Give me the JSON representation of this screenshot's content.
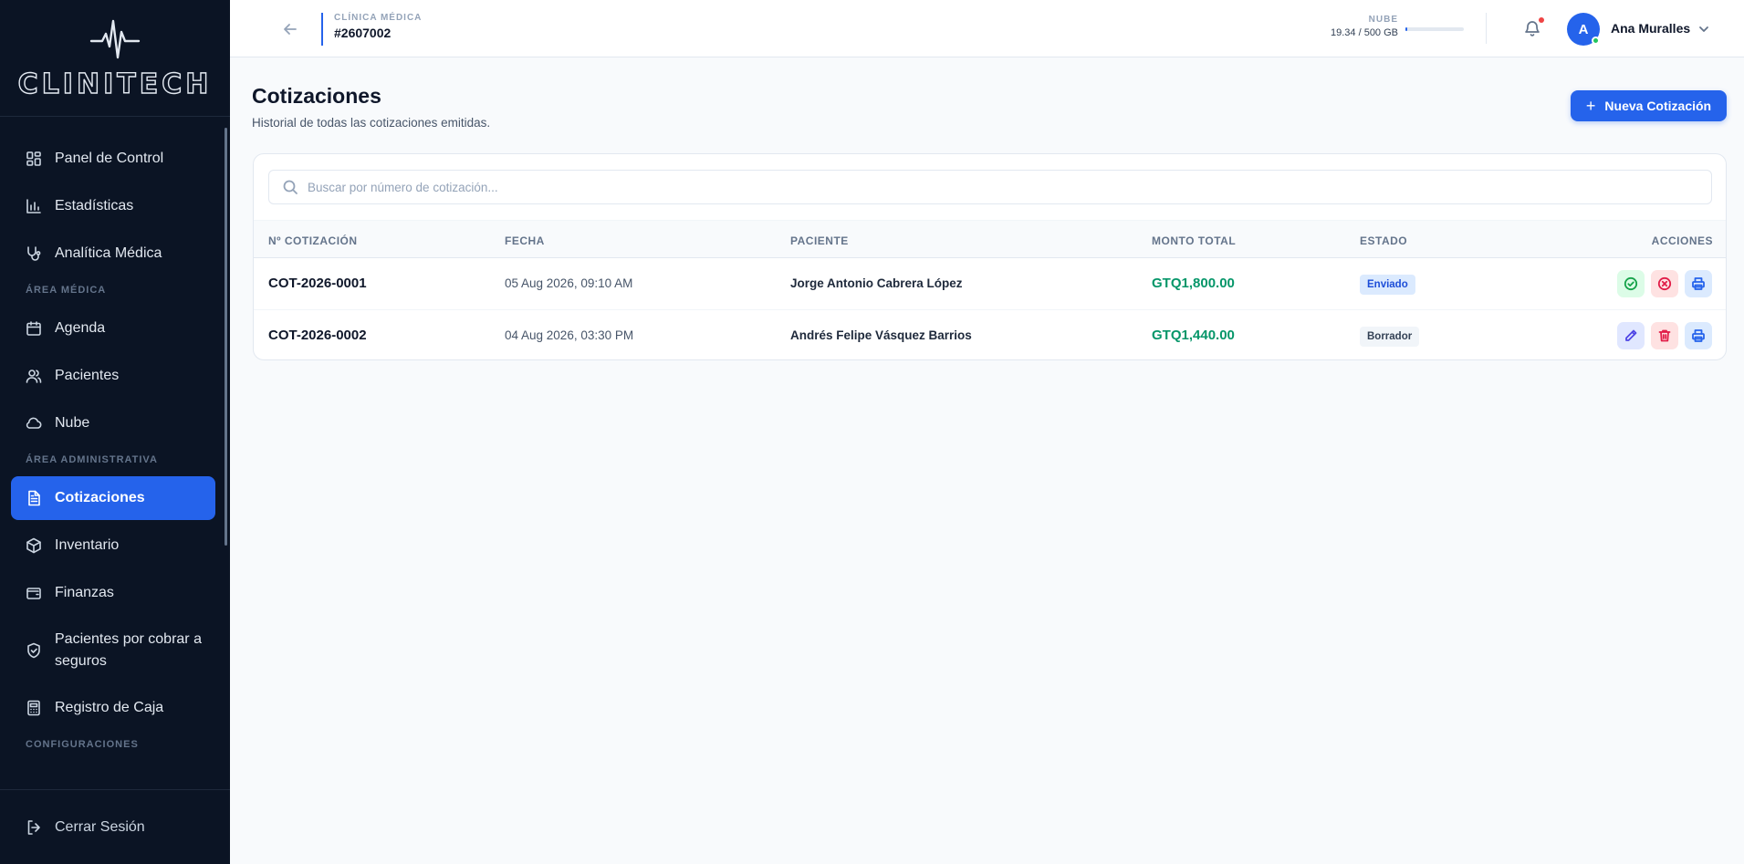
{
  "brand": {
    "name": "CLINITECH"
  },
  "sidebar": {
    "items_top": [
      {
        "label": "Panel de Control",
        "icon": "dashboard-icon"
      },
      {
        "label": "Estadísticas",
        "icon": "bar-chart-icon"
      },
      {
        "label": "Analítica Médica",
        "icon": "stethoscope-icon"
      }
    ],
    "section_medica": "ÁREA MÉDICA",
    "items_medica": [
      {
        "label": "Agenda",
        "icon": "calendar-icon"
      },
      {
        "label": "Pacientes",
        "icon": "users-icon"
      },
      {
        "label": "Nube",
        "icon": "cloud-icon"
      }
    ],
    "section_admin": "ÁREA ADMINISTRATIVA",
    "items_admin": [
      {
        "label": "Cotizaciones",
        "icon": "document-icon",
        "active": true
      },
      {
        "label": "Inventario",
        "icon": "box-icon"
      },
      {
        "label": "Finanzas",
        "icon": "wallet-icon"
      },
      {
        "label": "Pacientes por cobrar a seguros",
        "icon": "shield-icon"
      },
      {
        "label": "Registro de Caja",
        "icon": "calculator-icon"
      }
    ],
    "section_config": "CONFIGURACIONES",
    "logout_label": "Cerrar Sesión"
  },
  "header": {
    "clinic_label": "CLÍNICA MÉDICA",
    "clinic_id": "#2607002",
    "storage_label": "NUBE",
    "storage_value": "19.34 / 500 GB",
    "storage_fraction": 0.0387,
    "user_initial": "A",
    "user_name": "Ana Muralles"
  },
  "main": {
    "title": "Cotizaciones",
    "subtitle": "Historial de todas las cotizaciones emitidas.",
    "new_button": "Nueva Cotización",
    "search_placeholder": "Buscar por número de cotización...",
    "columns": [
      "Nº COTIZACIÓN",
      "FECHA",
      "PACIENTE",
      "MONTO TOTAL",
      "ESTADO",
      "ACCIONES"
    ],
    "rows": [
      {
        "number": "COT-2026-0001",
        "date": "05 Aug 2026, 09:10 AM",
        "patient": "Jorge Antonio Cabrera López",
        "amount": "GTQ1,800.00",
        "status": "Enviado"
      },
      {
        "number": "COT-2026-0002",
        "date": "04 Aug 2026, 03:30 PM",
        "patient": "Andrés Felipe Vásquez Barrios",
        "amount": "GTQ1,440.00",
        "status": "Borrador"
      }
    ]
  },
  "colors": {
    "accent": "#2563eb",
    "sidebar_bg": "#0b1424",
    "amount": "#059669"
  }
}
